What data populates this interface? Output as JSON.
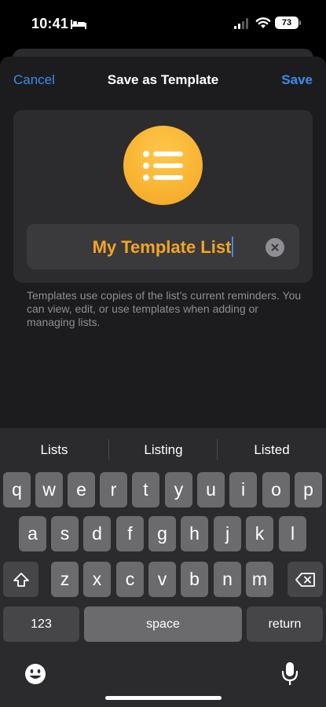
{
  "status": {
    "time": "10:41",
    "battery": "73"
  },
  "nav": {
    "cancel": "Cancel",
    "title": "Save as Template",
    "save": "Save"
  },
  "template": {
    "name": "My Template List"
  },
  "helper": "Templates use copies of the list’s current reminders. You can view, edit, or use templates when adding or managing lists.",
  "suggestions": [
    "Lists",
    "Listing",
    "Listed"
  ],
  "keys": {
    "row1": [
      "q",
      "w",
      "e",
      "r",
      "t",
      "y",
      "u",
      "i",
      "o",
      "p"
    ],
    "row2": [
      "a",
      "s",
      "d",
      "f",
      "g",
      "h",
      "j",
      "k",
      "l"
    ],
    "row3": [
      "z",
      "x",
      "c",
      "v",
      "b",
      "n",
      "m"
    ],
    "numbers": "123",
    "space": "space",
    "return": "return"
  },
  "colors": {
    "accent": "#3a8bf0",
    "list_icon": "#f4a522",
    "background": "#1c1c1e"
  }
}
